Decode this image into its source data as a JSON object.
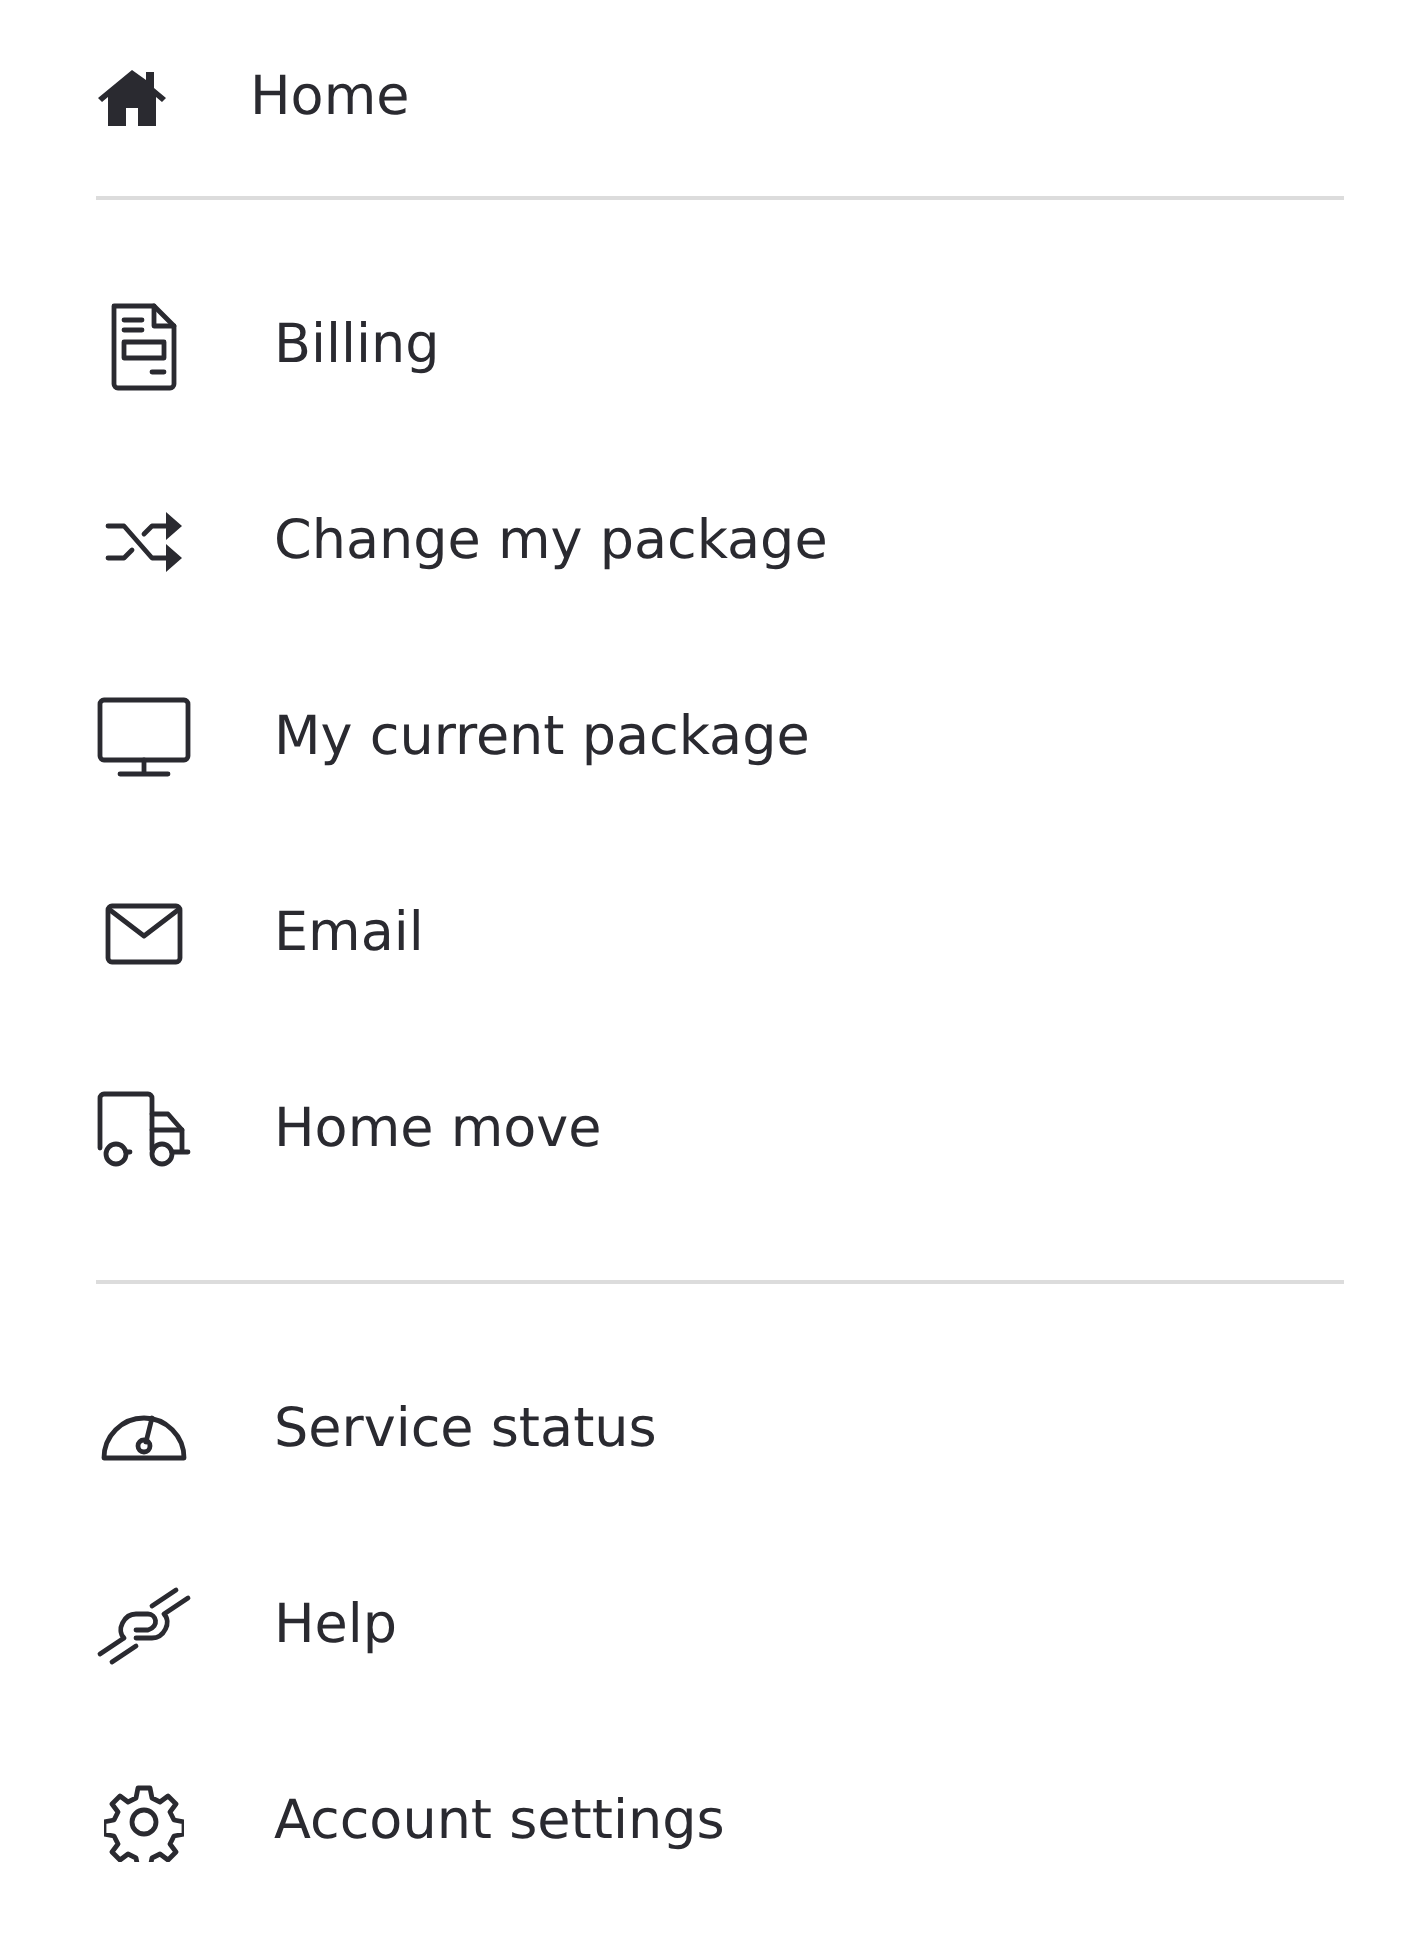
{
  "home": {
    "label": "Home"
  },
  "groups": [
    {
      "items": [
        {
          "label": "Billing"
        },
        {
          "label": "Change my package"
        },
        {
          "label": "My current package"
        },
        {
          "label": "Email"
        },
        {
          "label": "Home move"
        }
      ]
    },
    {
      "items": [
        {
          "label": "Service status"
        },
        {
          "label": "Help"
        },
        {
          "label": "Account settings"
        }
      ]
    }
  ]
}
